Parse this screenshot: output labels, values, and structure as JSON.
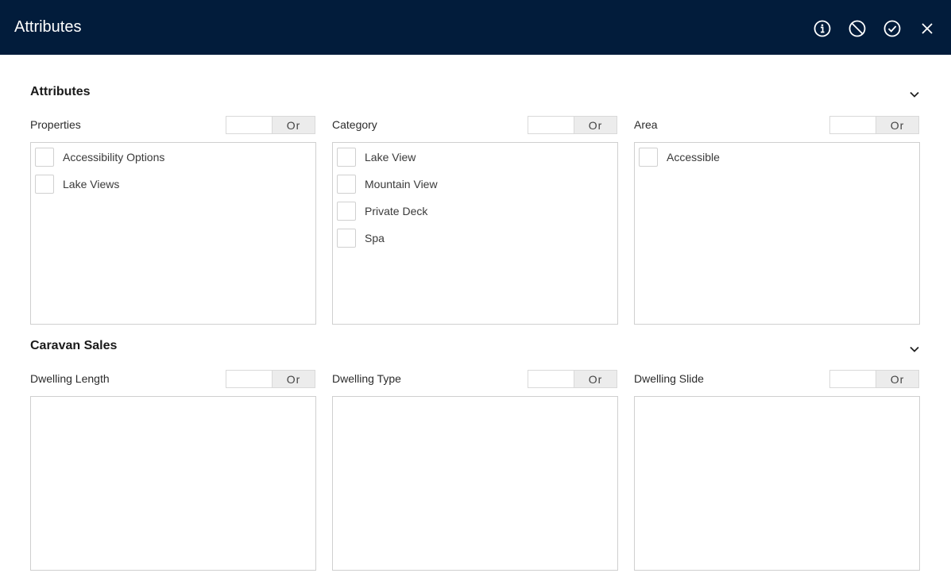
{
  "header": {
    "title": "Attributes",
    "actions": [
      {
        "name": "info-icon"
      },
      {
        "name": "cancel-icon"
      },
      {
        "name": "check-icon"
      },
      {
        "name": "close-icon"
      }
    ]
  },
  "sections": [
    {
      "title": "Attributes",
      "groups": [
        {
          "label": "Properties",
          "toggle": "Or",
          "items": [
            "Accessibility Options",
            "Lake Views"
          ]
        },
        {
          "label": "Category",
          "toggle": "Or",
          "items": [
            "Lake View",
            "Mountain View",
            "Private Deck",
            "Spa"
          ]
        },
        {
          "label": "Area",
          "toggle": "Or",
          "items": [
            "Accessible"
          ]
        }
      ]
    },
    {
      "title": "Caravan Sales",
      "groups": [
        {
          "label": "Dwelling Length",
          "toggle": "Or",
          "items": []
        },
        {
          "label": "Dwelling Type",
          "toggle": "Or",
          "items": []
        },
        {
          "label": "Dwelling Slide",
          "toggle": "Or",
          "items": []
        }
      ]
    }
  ],
  "colors": {
    "header_bg": "#021c3b",
    "toggle_active_bg": "#ececec"
  }
}
